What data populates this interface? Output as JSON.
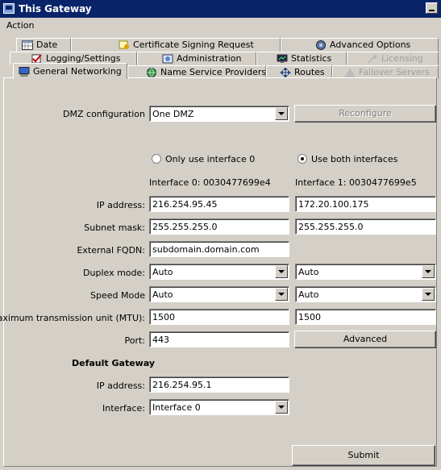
{
  "window": {
    "title": "This Gateway"
  },
  "menu": {
    "action": "Action"
  },
  "tabs": {
    "row1": [
      {
        "label": "Date",
        "icon": "calendar-icon"
      },
      {
        "label": "Certificate Signing Request",
        "icon": "certificate-icon"
      },
      {
        "label": "Advanced Options",
        "icon": "globe-gear-icon"
      }
    ],
    "row2": [
      {
        "label": "Logging/Settings",
        "icon": "checkmark-log-icon"
      },
      {
        "label": "Administration",
        "icon": "admin-icon"
      },
      {
        "label": "Statistics",
        "icon": "monitor-icon"
      },
      {
        "label": "Licensing",
        "icon": "key-icon",
        "disabled": true
      }
    ],
    "row3": [
      {
        "label": "General Networking",
        "icon": "computer-icon",
        "active": true
      },
      {
        "label": "Name Service Providers",
        "icon": "globe-icon"
      },
      {
        "label": "Routes",
        "icon": "arrows-icon"
      },
      {
        "label": "Failover Servers",
        "icon": "warning-icon",
        "disabled": true
      }
    ]
  },
  "form": {
    "dmz_label": "DMZ configuration",
    "dmz_value": "One DMZ",
    "reconfigure_label": "Reconfigure",
    "radio_only0_label": "Only use interface 0",
    "radio_both_label": "Use both interfaces",
    "iface0_header": "Interface 0: 0030477699e4",
    "iface1_header": "Interface 1: 0030477699e5",
    "ip_label": "IP address:",
    "ip0": "216.254.95.45",
    "ip1": "172.20.100.175",
    "mask_label": "Subnet mask:",
    "mask0": "255.255.255.0",
    "mask1": "255.255.255.0",
    "fqdn_label": "External FQDN:",
    "fqdn": "subdomain.domain.com",
    "duplex_label": "Duplex mode:",
    "duplex0": "Auto",
    "duplex1": "Auto",
    "speed_label": "Speed Mode",
    "speed0": "Auto",
    "speed1": "Auto",
    "mtu_label": "Maximum transmission unit (MTU):",
    "mtu0": "1500",
    "mtu1": "1500",
    "port_label": "Port:",
    "port": "443",
    "advanced_label": "Advanced",
    "gateway_header": "Default Gateway",
    "gw_ip_label": "IP address:",
    "gw_ip": "216.254.95.1",
    "gw_iface_label": "Interface:",
    "gw_iface": "Interface 0",
    "submit_label": "Submit"
  },
  "colors": {
    "titlebar": "#0a246a",
    "face": "#d4d0c8"
  }
}
